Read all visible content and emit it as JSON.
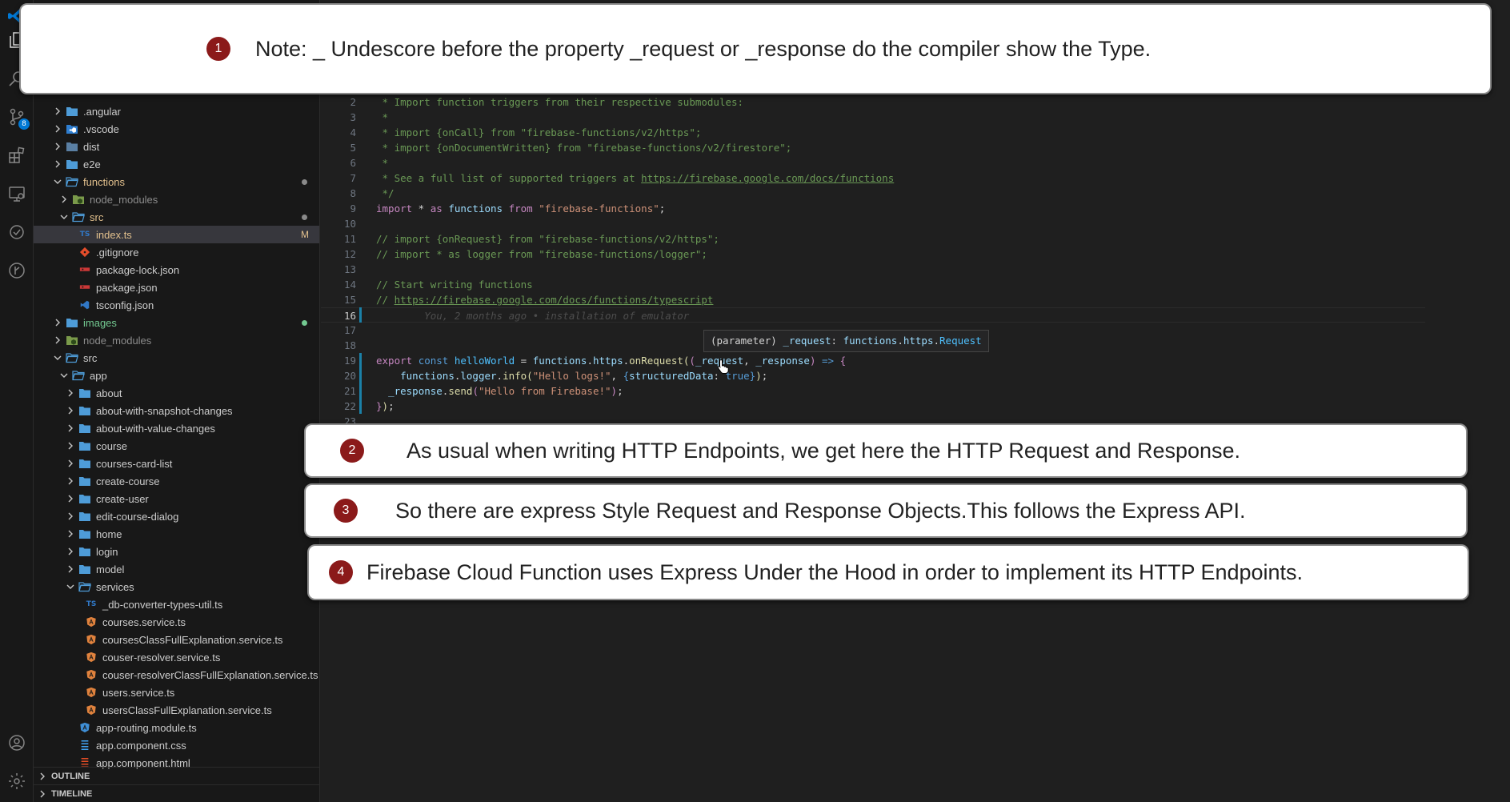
{
  "activity_bar": {
    "icons": [
      "explorer-icon",
      "search-icon",
      "source-control-icon",
      "extensions-icon",
      "remote-explorer-icon",
      "testing-icon",
      "git-graph-icon",
      "account-icon",
      "settings-gear-icon"
    ],
    "source_control_badge": "8"
  },
  "explorer": {
    "items": [
      {
        "label": ".angular",
        "type": "folder",
        "depth": 1,
        "expanded": false
      },
      {
        "label": ".vscode",
        "type": "folder-vscode",
        "depth": 1,
        "expanded": false
      },
      {
        "label": "dist",
        "type": "folder-dim",
        "depth": 1,
        "expanded": false
      },
      {
        "label": "e2e",
        "type": "folder",
        "depth": 1,
        "expanded": false
      },
      {
        "label": "functions",
        "type": "folder",
        "depth": 1,
        "expanded": true,
        "color": "#e2c08d",
        "dot": "#8a8a8a"
      },
      {
        "label": "node_modules",
        "type": "folder-node",
        "depth": 2,
        "expanded": false,
        "color": "#8c8c8c"
      },
      {
        "label": "src",
        "type": "folder",
        "depth": 2,
        "expanded": true,
        "color": "#e2c08d",
        "dot": "#8a8a8a"
      },
      {
        "label": "index.ts",
        "type": "file-ts",
        "depth": 3,
        "color": "#e2c08d",
        "badge": "M",
        "selected": true
      },
      {
        "label": ".gitignore",
        "type": "file-git",
        "depth": 3
      },
      {
        "label": "package-lock.json",
        "type": "file-npm",
        "depth": 3
      },
      {
        "label": "package.json",
        "type": "file-npm",
        "depth": 3
      },
      {
        "label": "tsconfig.json",
        "type": "file-tsconfig",
        "depth": 3
      },
      {
        "label": "images",
        "type": "folder",
        "depth": 1,
        "expanded": false,
        "color": "#73c991",
        "dot": "#73c991"
      },
      {
        "label": "node_modules",
        "type": "folder-node",
        "depth": 1,
        "expanded": false,
        "color": "#8c8c8c"
      },
      {
        "label": "src",
        "type": "folder",
        "depth": 1,
        "expanded": true
      },
      {
        "label": "app",
        "type": "folder",
        "depth": 2,
        "expanded": true
      },
      {
        "label": "about",
        "type": "folder",
        "depth": 3,
        "expanded": false
      },
      {
        "label": "about-with-snapshot-changes",
        "type": "folder",
        "depth": 3,
        "expanded": false
      },
      {
        "label": "about-with-value-changes",
        "type": "folder",
        "depth": 3,
        "expanded": false
      },
      {
        "label": "course",
        "type": "folder",
        "depth": 3,
        "expanded": false
      },
      {
        "label": "courses-card-list",
        "type": "folder",
        "depth": 3,
        "expanded": false
      },
      {
        "label": "create-course",
        "type": "folder",
        "depth": 3,
        "expanded": false
      },
      {
        "label": "create-user",
        "type": "folder",
        "depth": 3,
        "expanded": false
      },
      {
        "label": "edit-course-dialog",
        "type": "folder",
        "depth": 3,
        "expanded": false
      },
      {
        "label": "home",
        "type": "folder",
        "depth": 3,
        "expanded": false
      },
      {
        "label": "login",
        "type": "folder",
        "depth": 3,
        "expanded": false
      },
      {
        "label": "model",
        "type": "folder",
        "depth": 3,
        "expanded": false
      },
      {
        "label": "services",
        "type": "folder",
        "depth": 3,
        "expanded": true
      },
      {
        "label": "_db-converter-types-util.ts",
        "type": "file-ts",
        "depth": 4
      },
      {
        "label": "courses.service.ts",
        "type": "file-angular",
        "depth": 4
      },
      {
        "label": "coursesClassFullExplanation.service.ts",
        "type": "file-angular",
        "depth": 4
      },
      {
        "label": "couser-resolver.service.ts",
        "type": "file-angular",
        "depth": 4
      },
      {
        "label": "couser-resolverClassFullExplanation.service.ts",
        "type": "file-angular",
        "depth": 4
      },
      {
        "label": "users.service.ts",
        "type": "file-angular",
        "depth": 4
      },
      {
        "label": "usersClassFullExplanation.service.ts",
        "type": "file-angular",
        "depth": 4
      },
      {
        "label": "app-routing.module.ts",
        "type": "file-angular-module",
        "depth": 3
      },
      {
        "label": "app.component.css",
        "type": "file-css",
        "depth": 3
      },
      {
        "label": "app.component.html",
        "type": "file-html",
        "depth": 3
      }
    ],
    "sections": [
      "OUTLINE",
      "TIMELINE"
    ]
  },
  "editor": {
    "current_line": 16,
    "lines": [
      {
        "n": "2",
        "t": [
          [
            "c-cm",
            " * Import function triggers from their respective submodules:"
          ]
        ]
      },
      {
        "n": "3",
        "t": [
          [
            "c-cm",
            " *"
          ]
        ]
      },
      {
        "n": "4",
        "t": [
          [
            "c-cm",
            " * import {onCall} from \"firebase-functions/v2/https\";"
          ]
        ]
      },
      {
        "n": "5",
        "t": [
          [
            "c-cm",
            " * import {onDocumentWritten} from \"firebase-functions/v2/firestore\";"
          ]
        ]
      },
      {
        "n": "6",
        "t": [
          [
            "c-cm",
            " *"
          ]
        ]
      },
      {
        "n": "7",
        "t": [
          [
            "c-cm",
            " * See a full list of supported triggers at "
          ],
          [
            "c-url",
            "https://firebase.google.com/docs/functions"
          ]
        ]
      },
      {
        "n": "8",
        "t": [
          [
            "c-cm",
            " */"
          ]
        ]
      },
      {
        "n": "9",
        "t": [
          [
            "c-kw2",
            "import"
          ],
          [
            "c-plain",
            " * "
          ],
          [
            "c-kw2",
            "as"
          ],
          [
            "c-plain",
            " "
          ],
          [
            "c-var",
            "functions"
          ],
          [
            "c-plain",
            " "
          ],
          [
            "c-kw2",
            "from"
          ],
          [
            "c-plain",
            " "
          ],
          [
            "c-str",
            "\"firebase-functions\""
          ],
          [
            "c-plain",
            ";"
          ]
        ]
      },
      {
        "n": "10",
        "t": []
      },
      {
        "n": "11",
        "t": [
          [
            "c-cm",
            "// import {onRequest} from \"firebase-functions/v2/https\";"
          ]
        ]
      },
      {
        "n": "12",
        "t": [
          [
            "c-cm",
            "// import * as logger from \"firebase-functions/logger\";"
          ]
        ]
      },
      {
        "n": "13",
        "t": []
      },
      {
        "n": "14",
        "t": [
          [
            "c-cm",
            "// Start writing functions"
          ]
        ]
      },
      {
        "n": "15",
        "t": [
          [
            "c-cm",
            "// "
          ],
          [
            "c-url",
            "https://firebase.google.com/docs/functions/typescript"
          ]
        ]
      },
      {
        "n": "16",
        "t": [
          [
            "c-ghost",
            "        You, 2 months ago • installation of emulator"
          ]
        ]
      },
      {
        "n": "17",
        "t": []
      },
      {
        "n": "18",
        "t": []
      },
      {
        "n": "19",
        "t": [
          [
            "c-kw2",
            "export"
          ],
          [
            "c-plain",
            " "
          ],
          [
            "c-kw",
            "const"
          ],
          [
            "c-plain",
            " "
          ],
          [
            "c-const",
            "helloWorld"
          ],
          [
            "c-plain",
            " = "
          ],
          [
            "c-var",
            "functions"
          ],
          [
            "c-plain",
            "."
          ],
          [
            "c-var",
            "https"
          ],
          [
            "c-plain",
            "."
          ],
          [
            "c-fn",
            "onRequest"
          ],
          [
            "c-fn",
            "("
          ],
          [
            "c-kw2",
            "("
          ],
          [
            "c-var",
            "_request"
          ],
          [
            "c-plain",
            ", "
          ],
          [
            "c-var",
            "_response"
          ],
          [
            "c-kw2",
            ")"
          ],
          [
            "c-plain",
            " "
          ],
          [
            "c-kw",
            "=>"
          ],
          [
            "c-plain",
            " "
          ],
          [
            "c-kw2",
            "{"
          ]
        ]
      },
      {
        "n": "20",
        "t": [
          [
            "c-plain",
            "    "
          ],
          [
            "c-var",
            "functions"
          ],
          [
            "c-plain",
            "."
          ],
          [
            "c-var",
            "logger"
          ],
          [
            "c-plain",
            "."
          ],
          [
            "c-fn",
            "info"
          ],
          [
            "c-fn",
            "("
          ],
          [
            "c-str",
            "\"Hello logs!\""
          ],
          [
            "c-plain",
            ", "
          ],
          [
            "c-kw",
            "{"
          ],
          [
            "c-var",
            "structuredData"
          ],
          [
            "c-plain",
            ": "
          ],
          [
            "c-kw",
            "true"
          ],
          [
            "c-kw",
            "}"
          ],
          [
            "c-fn",
            ")"
          ],
          [
            "c-plain",
            ";"
          ]
        ]
      },
      {
        "n": "21",
        "t": [
          [
            "c-plain",
            "  "
          ],
          [
            "c-var",
            "_response"
          ],
          [
            "c-plain",
            "."
          ],
          [
            "c-fn",
            "send"
          ],
          [
            "c-kw2",
            "("
          ],
          [
            "c-str",
            "\"Hello from Firebase!\""
          ],
          [
            "c-kw2",
            ")"
          ],
          [
            "c-plain",
            ";"
          ]
        ]
      },
      {
        "n": "22",
        "t": [
          [
            "c-kw2",
            "}"
          ],
          [
            "c-fn",
            ")"
          ],
          [
            "c-plain",
            ";"
          ]
        ]
      },
      {
        "n": "23",
        "t": []
      }
    ],
    "hover_tooltip": [
      [
        "c-plain",
        "(parameter) "
      ],
      [
        "c-var",
        "_request"
      ],
      [
        "c-plain",
        ": "
      ],
      [
        "c-var",
        "functions"
      ],
      [
        "c-plain",
        "."
      ],
      [
        "c-var",
        "https"
      ],
      [
        "c-plain",
        "."
      ],
      [
        "c-const",
        "Request"
      ]
    ]
  },
  "callouts": [
    {
      "num": "1",
      "text": "Note: _ Undescore before the property _request or _response do the compiler show the Type."
    },
    {
      "num": "2",
      "text": "As usual when writing HTTP Endpoints, we get here the HTTP Request and Response."
    },
    {
      "num": "3",
      "text": "So there are express Style Request and Response Objects.This follows the Express API."
    },
    {
      "num": "4",
      "text": "Firebase Cloud Function uses Express Under the Hood in order to implement its HTTP Endpoints."
    }
  ]
}
